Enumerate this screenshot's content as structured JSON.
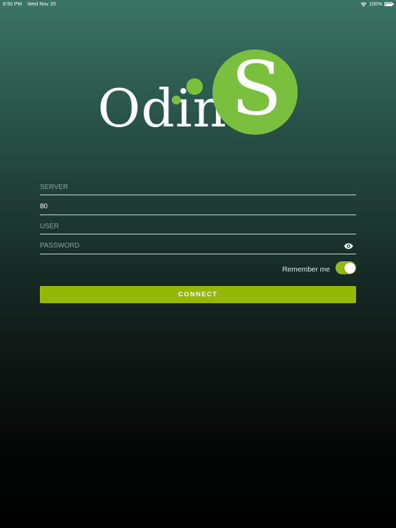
{
  "status_bar": {
    "time": "8:50 PM",
    "date": "Wed Nov 20",
    "battery": "100%",
    "battery_level": 1.0
  },
  "logo": {
    "word": "Odin",
    "circle_letter": "S",
    "brand_color": "#7bbf3f"
  },
  "form": {
    "server": {
      "placeholder": "SERVER",
      "value": ""
    },
    "port": {
      "placeholder": "",
      "value": "80"
    },
    "user": {
      "placeholder": "USER",
      "value": ""
    },
    "password": {
      "placeholder": "PASSWORD",
      "value": "",
      "icon": "eye-icon"
    }
  },
  "remember": {
    "label": "Remember me",
    "enabled": true,
    "toggle_color": "#8fba1c"
  },
  "connect": {
    "label": "CONNECT",
    "color": "#94b900"
  }
}
